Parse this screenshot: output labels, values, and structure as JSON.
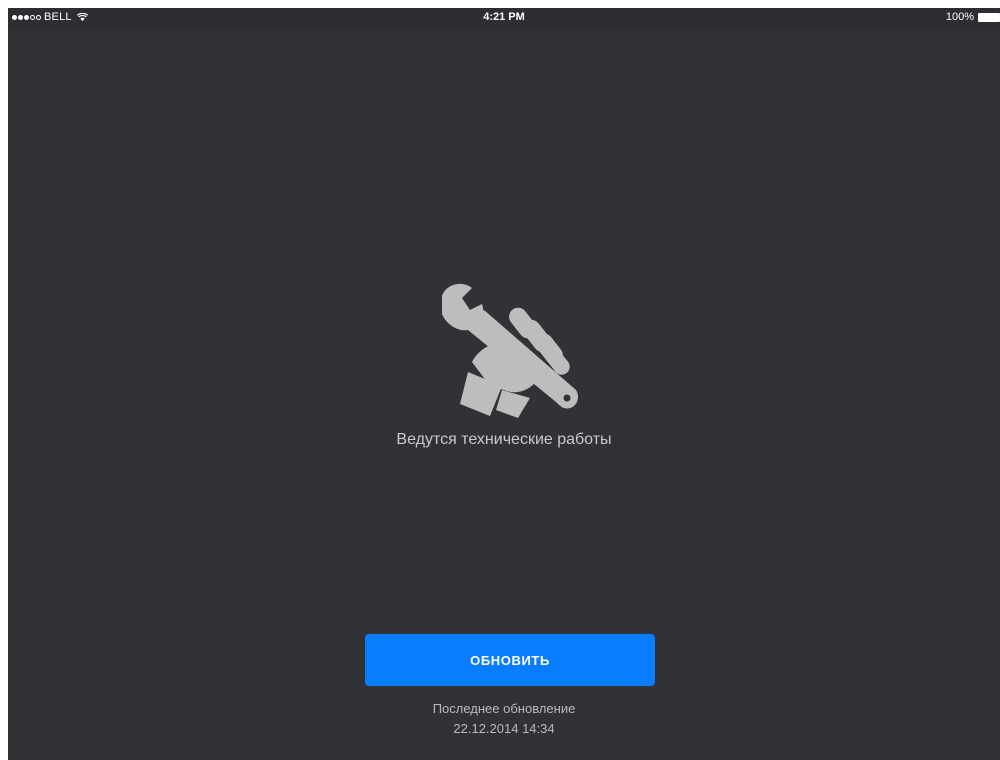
{
  "status_bar": {
    "carrier": "BELL",
    "time": "4:21 PM",
    "battery": "100%"
  },
  "icons": {
    "status": [
      "signal-dots",
      "wifi-icon",
      "battery-icon"
    ],
    "main": "wrench-hand-icon"
  },
  "main": {
    "message": "Ведутся технические работы",
    "refresh_button_label": "ОБНОВИТЬ",
    "last_update_label": "Последнее обновление",
    "last_update_value": "22.12.2014 14:34"
  },
  "colors": {
    "background": "#303236",
    "accent": "#0a7cff",
    "icon": "#bdbdbd",
    "text_secondary": "#c9cacc"
  }
}
